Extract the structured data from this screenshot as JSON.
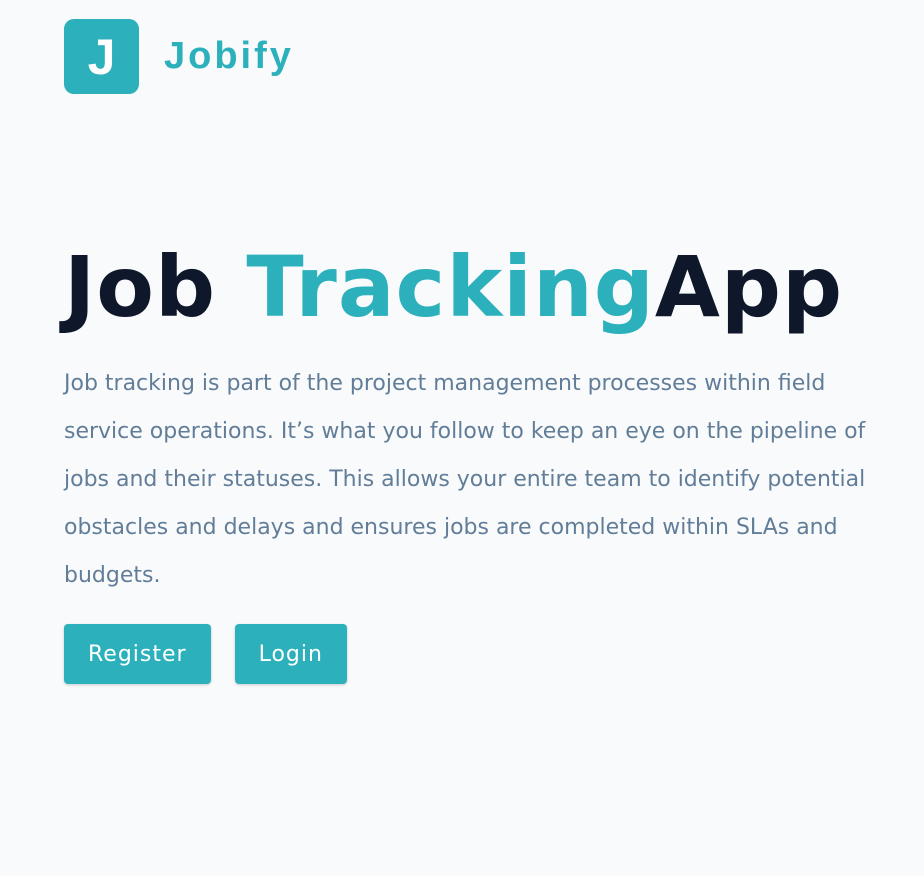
{
  "brand": {
    "logo_letter": "J",
    "name": "Jobify",
    "accent_color": "#2cb1bc"
  },
  "hero": {
    "title_part1": "Job ",
    "title_accent": "Tracking",
    "title_part2": "App",
    "description": "Job tracking is part of the project management processes within field service operations. It’s what you follow to keep an eye on the pipeline of jobs and their statuses. This allows your entire team to identify potential obstacles and delays and ensures jobs are completed within SLAs and budgets."
  },
  "actions": {
    "register_label": "Register",
    "login_label": "Login"
  }
}
